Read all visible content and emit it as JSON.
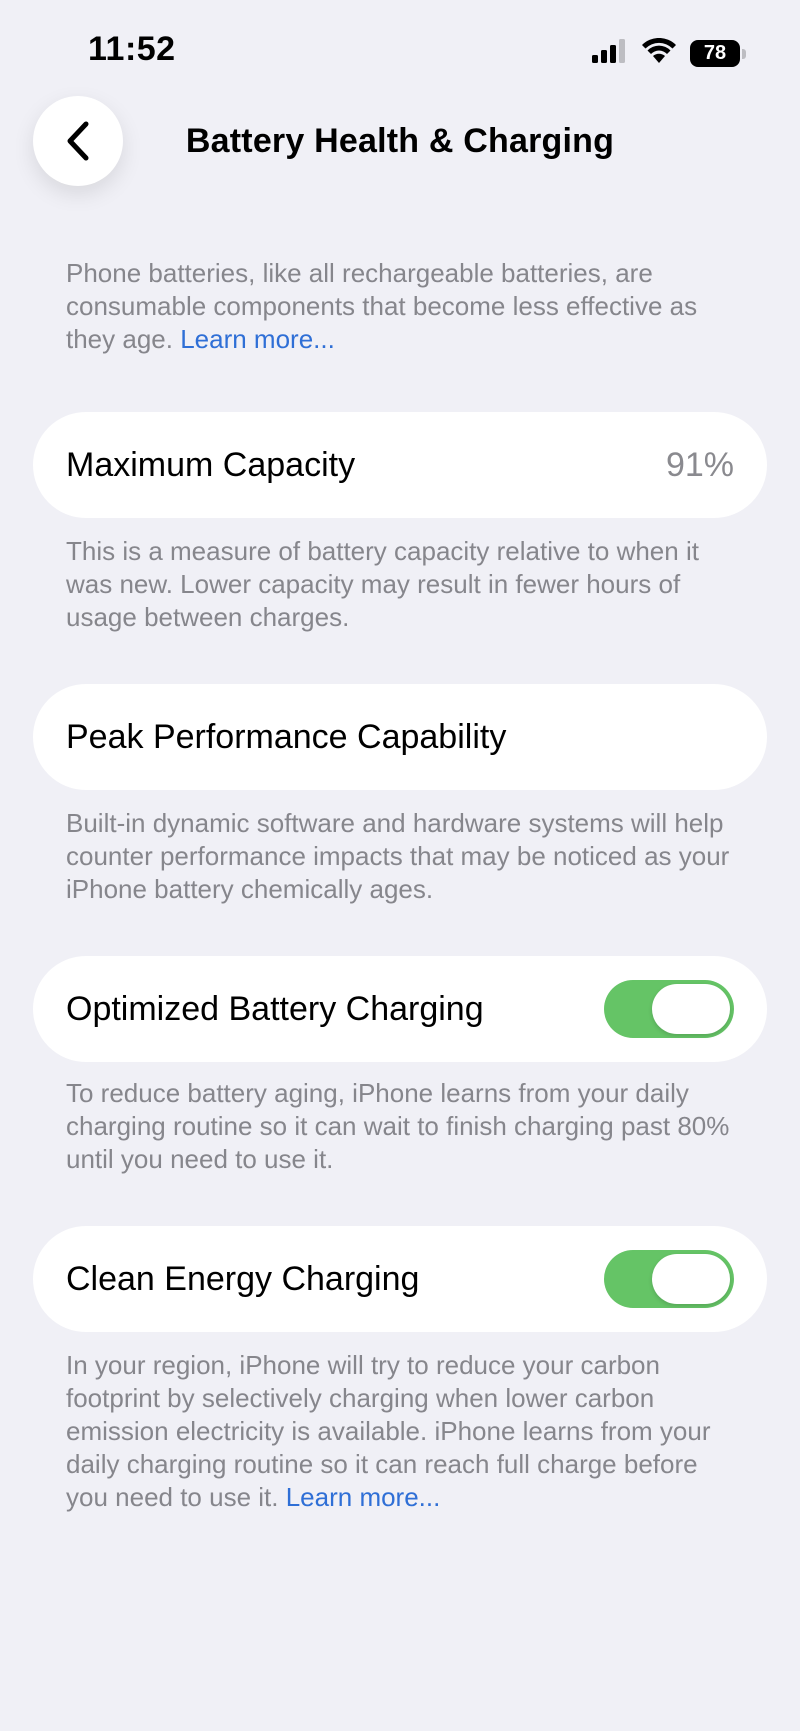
{
  "status_bar": {
    "time": "11:52",
    "battery_level": "78",
    "icons": [
      "cellular-signal-icon",
      "wifi-icon",
      "battery-icon"
    ]
  },
  "nav": {
    "back_icon": "chevron-left-icon",
    "title": "Battery Health & Charging"
  },
  "intro": {
    "text": "Phone batteries, like all rechargeable batteries, are consumable components that become less effective as they age. ",
    "link": "Learn more..."
  },
  "max_capacity": {
    "label": "Maximum Capacity",
    "value": "91%",
    "footnote": "This is a measure of battery capacity relative to when it was new. Lower capacity may result in fewer hours of usage between charges."
  },
  "peak_performance": {
    "label": "Peak Performance Capability",
    "footnote": "Built-in dynamic software and hardware systems will help counter performance impacts that may be noticed as your iPhone battery chemically ages."
  },
  "optimized_charging": {
    "label": "Optimized Battery Charging",
    "enabled": true,
    "footnote": "To reduce battery aging, iPhone learns from your daily charging routine so it can wait to finish charging past 80% until you need to use it."
  },
  "clean_energy": {
    "label": "Clean Energy Charging",
    "enabled": true,
    "footnote": "In your region, iPhone will try to reduce your carbon footprint by selectively charging when lower carbon emission electricity is available. iPhone learns from your daily charging routine so it can reach full charge before you need to use it. ",
    "link": "Learn more..."
  },
  "colors": {
    "background": "#f0f0f6",
    "toggle_on": "#65c466",
    "link": "#2f6fd6",
    "secondary_text": "#86868c"
  }
}
